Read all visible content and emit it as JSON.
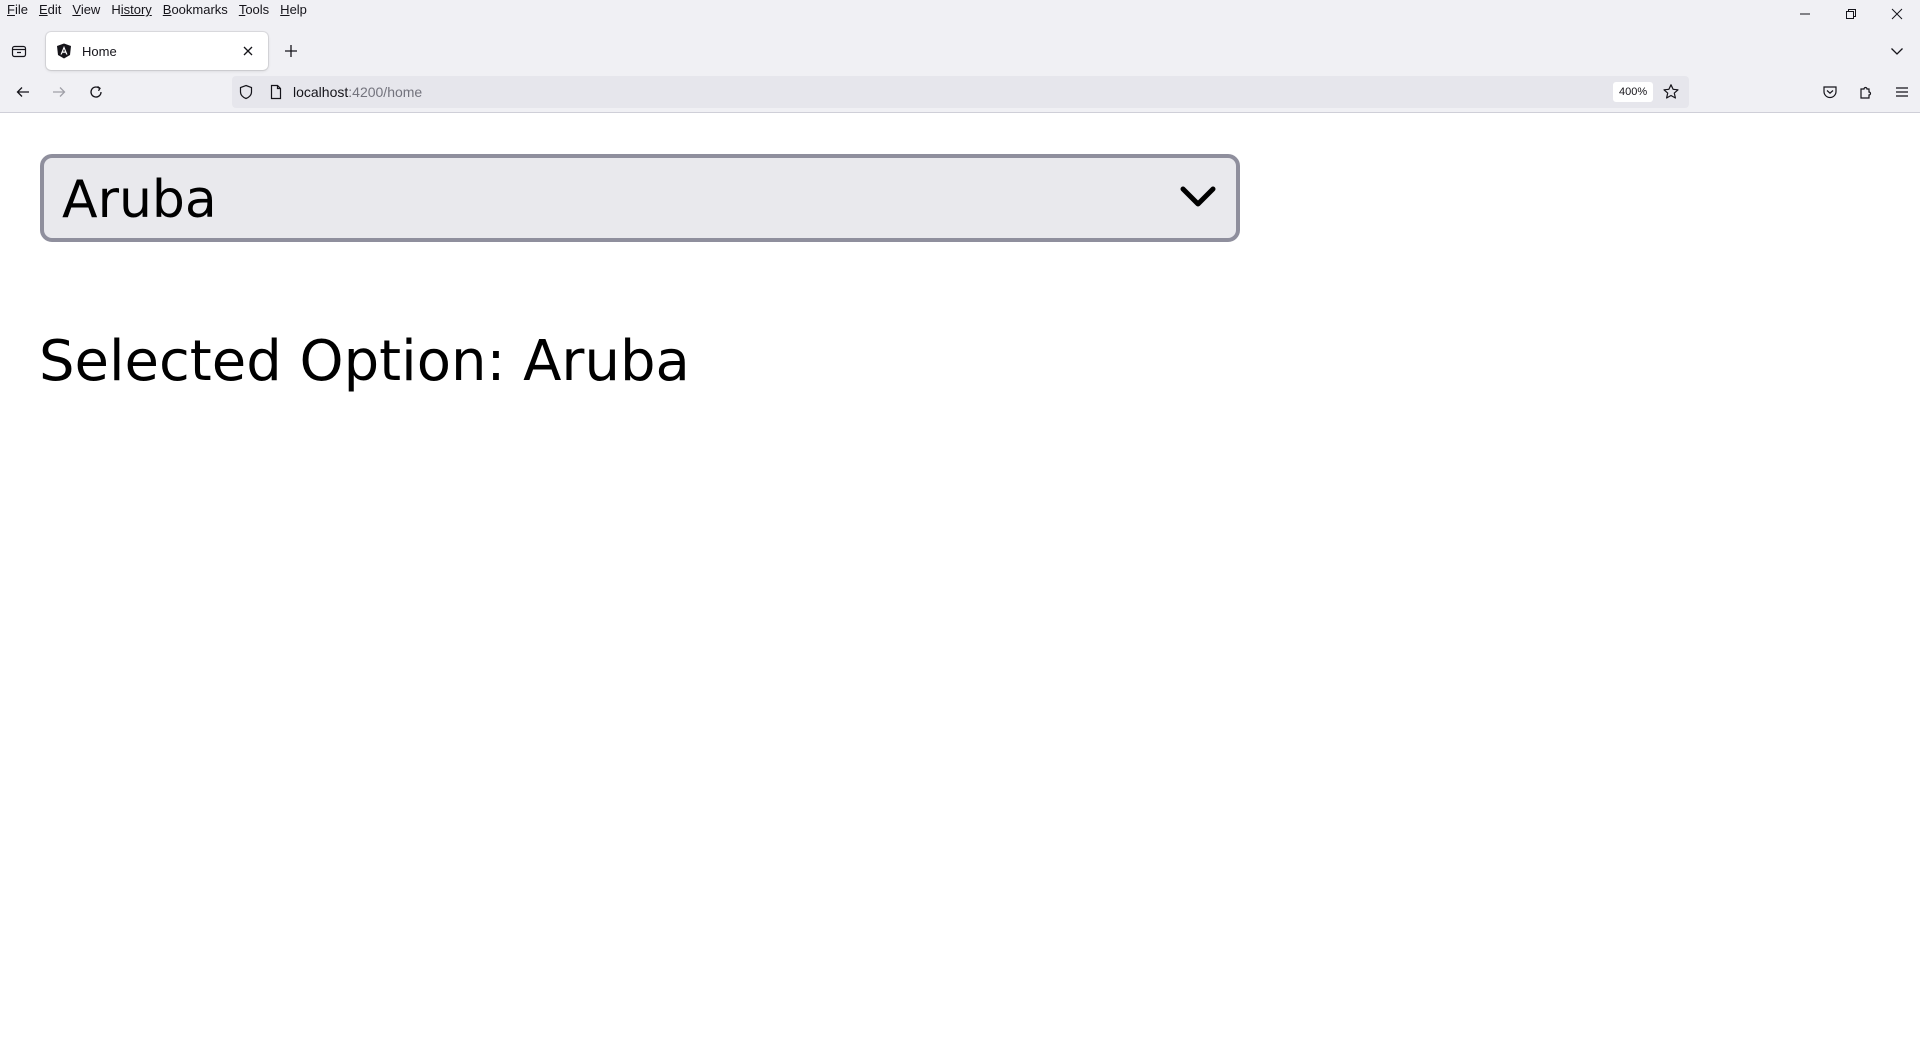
{
  "menubar": {
    "items": [
      {
        "label": "File",
        "accel": "F",
        "rest": "ile"
      },
      {
        "label": "Edit",
        "accel": "E",
        "rest": "dit"
      },
      {
        "label": "View",
        "accel": "V",
        "rest": "iew"
      },
      {
        "label": "History",
        "accel": "H",
        "rest": "istory"
      },
      {
        "label": "Bookmarks",
        "accel": "B",
        "rest": "ookmarks"
      },
      {
        "label": "Tools",
        "accel": "T",
        "rest": "ools"
      },
      {
        "label": "Help",
        "accel": "H",
        "rest": "elp"
      }
    ]
  },
  "tabs": [
    {
      "title": "Home",
      "favicon": "angular-icon",
      "active": true
    }
  ],
  "navbar": {
    "url_host": "localhost",
    "url_rest": ":4200/home",
    "zoom": "400%"
  },
  "page": {
    "select": {
      "value": "Aruba"
    },
    "selected_option_text": "Selected Option: Aruba"
  },
  "colors": {
    "chrome_bg": "#f0f0f4",
    "urlbar_bg": "#e6e6ec",
    "select_bg": "#e9e9ed",
    "select_border": "#8f8f9d",
    "text": "#000000"
  }
}
